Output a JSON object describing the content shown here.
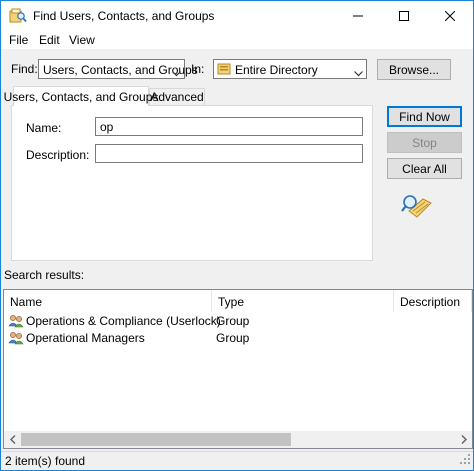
{
  "window": {
    "title": "Find Users, Contacts, and Groups",
    "title_icon": "directory-search-icon",
    "controls": [
      "minimize-icon",
      "maximize-icon",
      "close-icon"
    ]
  },
  "menu": {
    "items": [
      {
        "label": "File"
      },
      {
        "label": "Edit"
      },
      {
        "label": "View"
      }
    ]
  },
  "find": {
    "label": "Find:",
    "selected": "Users, Contacts, and Groups"
  },
  "in": {
    "label": "In:",
    "selected": "Entire Directory",
    "icon": "directory-folder-icon"
  },
  "browse_label": "Browse...",
  "tabs": [
    {
      "label": "Users, Contacts, and Groups",
      "active": true
    },
    {
      "label": "Advanced",
      "active": false
    }
  ],
  "form": {
    "name_label": "Name:",
    "name_value": "op",
    "description_label": "Description:",
    "description_value": ""
  },
  "buttons": {
    "find_now": "Find Now",
    "stop": "Stop",
    "clear_all": "Clear All"
  },
  "search_icon": "magnifier-search-icon",
  "results": {
    "label": "Search results:",
    "columns": [
      "Name",
      "Type",
      "Description"
    ],
    "rows": [
      {
        "name": "Operations & Compliance (Userlock)",
        "type": "Group",
        "description": "",
        "icon": "group-icon"
      },
      {
        "name": "Operational Managers",
        "type": "Group",
        "description": "",
        "icon": "group-icon"
      }
    ]
  },
  "status": "2 item(s) found",
  "colors": {
    "accent": "#0078d7",
    "window_border": "#1883d7",
    "face": "#f0f0f0",
    "disabled_text": "#838383"
  }
}
